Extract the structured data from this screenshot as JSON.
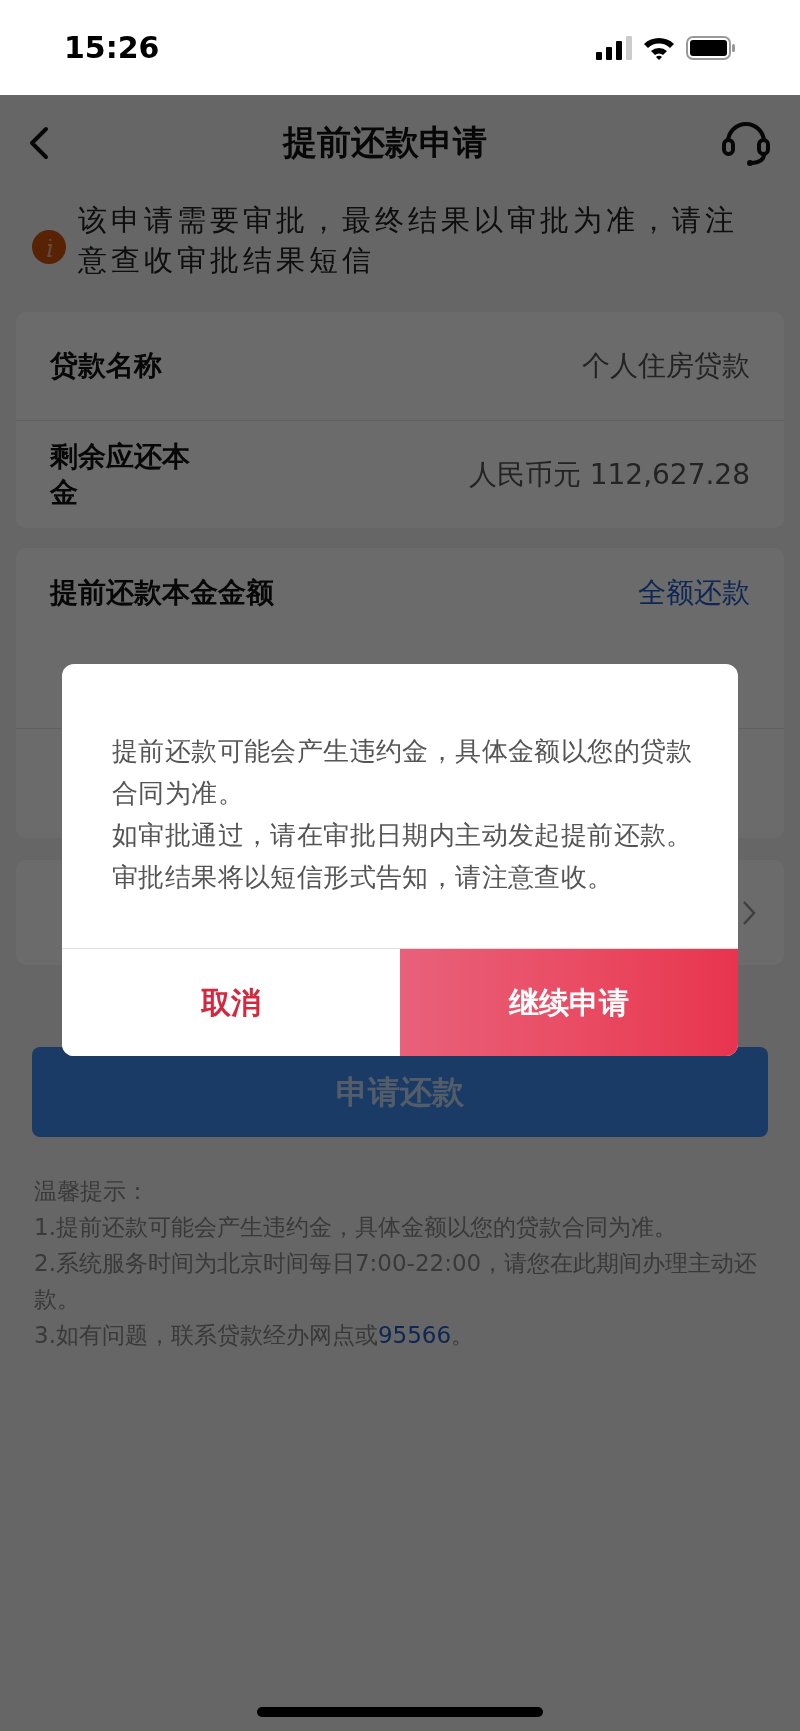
{
  "status_bar": {
    "time": "15:26"
  },
  "nav": {
    "title": "提前还款申请"
  },
  "notice": {
    "text": "该申请需要审批，最终结果以审批为准，请注意查收审批结果短信"
  },
  "loan_info": [
    {
      "label": "贷款名称",
      "value": "个人住房贷款"
    },
    {
      "label": "剩余应还本金",
      "value": "人民币元 112,627.28"
    }
  ],
  "prepay": {
    "label": "提前还款本金金额",
    "action": "全额还款"
  },
  "submit_button": {
    "label": "申请还款"
  },
  "tips": {
    "title": "温馨提示：",
    "items": [
      {
        "text": "1.提前还款可能会产生违约金，具体金额以您的贷款合同为准。"
      },
      {
        "text": "2.系统服务时间为北京时间每日7:00-22:00，请您在此期间办理主动还款。"
      },
      {
        "text": "3.如有问题，联系贷款经办网点或",
        "link": "95566",
        "suffix": "。"
      }
    ]
  },
  "dialog": {
    "paragraphs": [
      "提前还款可能会产生违约金，具体金额以您的贷款合同为准。",
      "如审批通过，请在审批日期内主动发起提前还款。审批结果将以短信形式告知，请注意查收。"
    ],
    "buttons": [
      {
        "label": "取消",
        "kind": "secondary"
      },
      {
        "label": "继续申请",
        "kind": "primary"
      }
    ]
  }
}
